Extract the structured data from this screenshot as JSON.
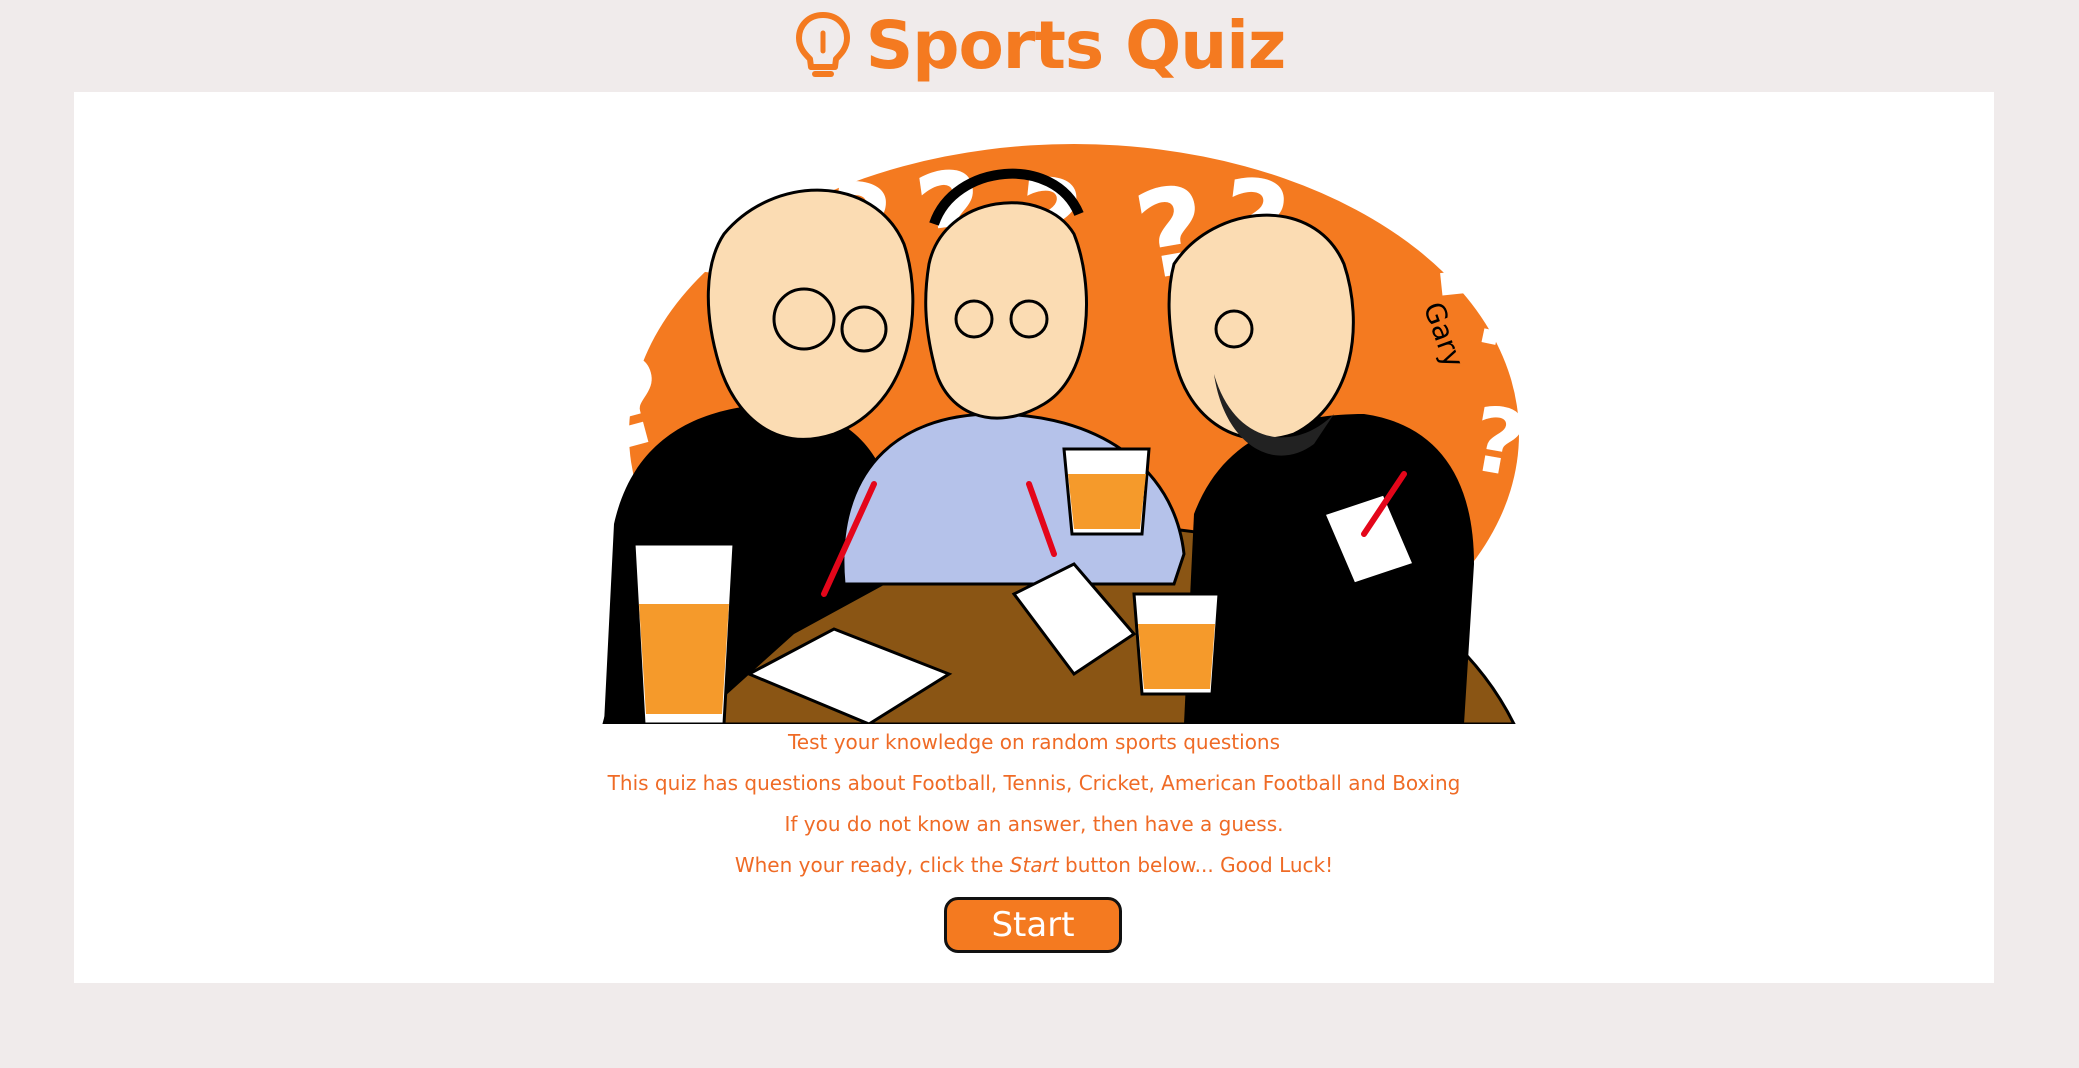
{
  "colors": {
    "page_background": "#f0ebeb",
    "card_background": "#ffffff",
    "accent": "#f47a20",
    "text": "#ef6b26",
    "button_border": "#111111"
  },
  "header": {
    "icon": "lightbulb-icon",
    "title": "Sports Quiz"
  },
  "intro": {
    "line1": "Test your knowledge on random sports questions",
    "line2": "This quiz has questions about Football, Tennis, Cricket, American Football and Boxing",
    "line3": "If you do not know an answer, then have a guess.",
    "line4_before": "When your ready, click the ",
    "line4_emphasis": "Start",
    "line4_after": " button below... Good Luck!"
  },
  "start_button": {
    "label": "Start"
  },
  "illustration": {
    "signature": "Gary"
  }
}
